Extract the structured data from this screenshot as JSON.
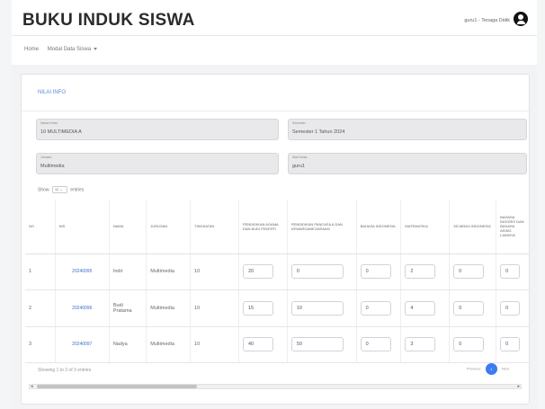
{
  "app": {
    "title": "BUKU INDUK SISWA",
    "user": "guru1 - Tenaga Didik"
  },
  "nav": {
    "home": "Home",
    "modal": "Modal Data Siswa"
  },
  "card": {
    "title": "NILAI INFO",
    "fields": {
      "kelas": {
        "label": "Nama Kelas",
        "value": "10 MULTIMEDIA A"
      },
      "semester": {
        "label": "Semester",
        "value": "Semester 1 Tahun 2024"
      },
      "jurusan": {
        "label": "Jurusan",
        "value": "Multimedia"
      },
      "wali": {
        "label": "Wali Kelas",
        "value": "guru1"
      }
    }
  },
  "table": {
    "show_prefix": "Show",
    "entries_value": "10",
    "show_suffix": "entries",
    "headers": [
      "NO",
      "NIS",
      "NAMA",
      "JURUSAN",
      "TINGKATAN",
      "PENDIDIKAN AGAMA DAN BUDI PEKERTI",
      "PENDIDIKAN PANCASILA DAN KEWARGANEGARAAN",
      "BAHASA INDONESIA",
      "MATEMATIKA",
      "SEJARAH INDONESIA",
      "BAHASA INGGRIS DAN BAHASA ASING LAINNYA"
    ],
    "rows": [
      {
        "no": "1",
        "nis": "20240095",
        "nama": "Indri",
        "jurusan": "Multimedia",
        "tingkatan": "10",
        "agama": "20",
        "pancasila": "0",
        "indonesia": "0",
        "matematika": "2",
        "sejarah": "0",
        "inggris": "0"
      },
      {
        "no": "2",
        "nis": "20240096",
        "nama": "Budi Pratama",
        "jurusan": "Multimedia",
        "tingkatan": "10",
        "agama": "15",
        "pancasila": "10",
        "indonesia": "0",
        "matematika": "4",
        "sejarah": "0",
        "inggris": "0"
      },
      {
        "no": "3",
        "nis": "20240097",
        "nama": "Nadya",
        "jurusan": "Multimedia",
        "tingkatan": "10",
        "agama": "40",
        "pancasila": "50",
        "indonesia": "0",
        "matematika": "3",
        "sejarah": "0",
        "inggris": "0"
      }
    ],
    "footer": "Showing 1 to 3 of 3 entries",
    "pager": {
      "previous": "Previous",
      "page": "1",
      "next": "Next"
    }
  },
  "colors": {
    "accent": "#3d7bf2",
    "link": "#3b6fc9"
  }
}
